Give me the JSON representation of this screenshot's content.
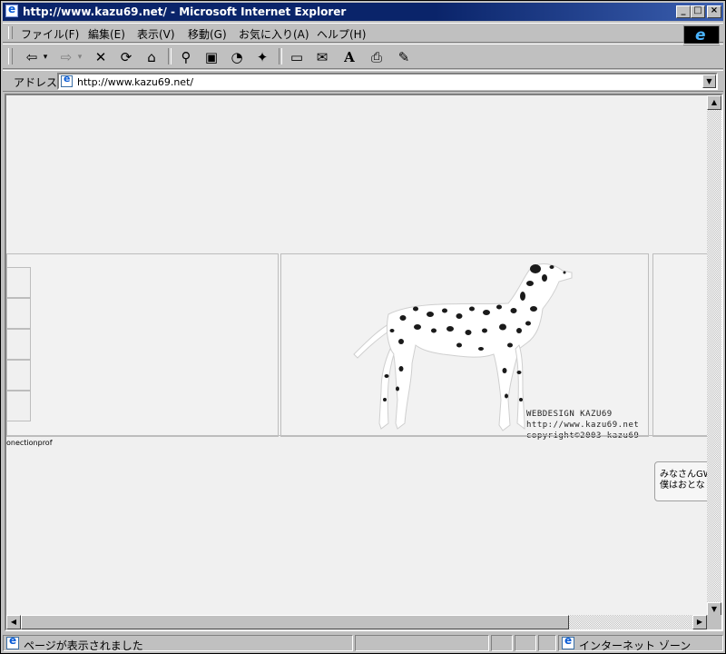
{
  "window": {
    "title": "http://www.kazu69.net/ - Microsoft Internet Explorer",
    "minimize_glyph": "_",
    "maximize_glyph": "□",
    "close_glyph": "×"
  },
  "menu": {
    "items": [
      {
        "label": "ファイル(F)"
      },
      {
        "label": "編集(E)"
      },
      {
        "label": "表示(V)"
      },
      {
        "label": "移動(G)"
      },
      {
        "label": "お気に入り(A)"
      },
      {
        "label": "ヘルプ(H)"
      }
    ]
  },
  "toolbar": {
    "back_glyph": "⇦",
    "forward_glyph": "⇨",
    "stop_glyph": "✕",
    "refresh_glyph": "⟳",
    "home_glyph": "⌂",
    "search_glyph": "⚲",
    "favorites_glyph": "▣",
    "history_glyph": "◔",
    "channels_glyph": "✦",
    "fullscreen_glyph": "▭",
    "mail_glyph": "✉",
    "font_glyph": "A",
    "print_glyph": "⎙",
    "edit_glyph": "✎",
    "dropdown_glyph": "▾"
  },
  "address": {
    "label": "アドレス",
    "url": "http://www.kazu69.net/",
    "dropdown_glyph": "▼"
  },
  "page": {
    "credits": [
      "WEBDESIGN KAZU69",
      "http://www.kazu69.net",
      "copyright©2003 kazu69"
    ],
    "footer_text": "onectionprof",
    "note_lines": [
      "みなさんGW",
      "僕はおとな"
    ]
  },
  "scroll": {
    "up_glyph": "▲",
    "down_glyph": "▼",
    "left_glyph": "◀",
    "right_glyph": "▶"
  },
  "status": {
    "message": "ページが表示されました",
    "zone": "インターネット ゾーン"
  },
  "colors": {
    "titlebar": "#0a246a",
    "chrome": "#c0c0c0",
    "page_bg": "#f0f0f0"
  }
}
